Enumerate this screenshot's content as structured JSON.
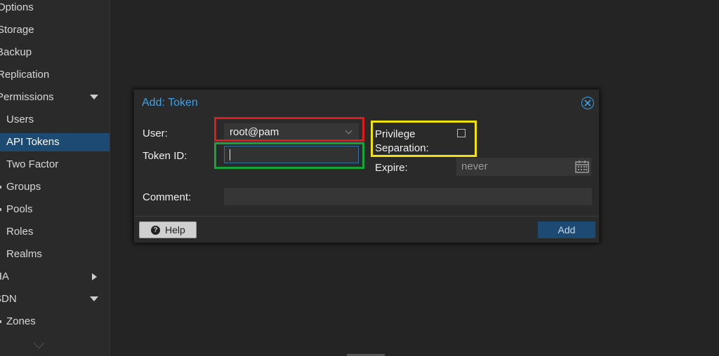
{
  "sidebar": {
    "items": [
      {
        "label": "Options"
      },
      {
        "label": "Storage"
      },
      {
        "label": "Backup"
      },
      {
        "label": "Replication"
      },
      {
        "label": "Permissions",
        "expanded": true
      },
      {
        "label": "Users"
      },
      {
        "label": "API Tokens",
        "selected": true
      },
      {
        "label": "Two Factor"
      },
      {
        "label": "Groups"
      },
      {
        "label": "Pools"
      },
      {
        "label": "Roles"
      },
      {
        "label": "Realms"
      },
      {
        "label": "HA",
        "expanded": false
      },
      {
        "label": "SDN",
        "expanded": true
      },
      {
        "label": "Zones"
      }
    ]
  },
  "dialog": {
    "title": "Add: Token",
    "user_label": "User:",
    "user_value": "root@pam",
    "token_id_label": "Token ID:",
    "token_id_value": "",
    "privsep_label_line1": "Privilege",
    "privsep_label_line2": "Separation:",
    "privsep_checked": false,
    "expire_label": "Expire:",
    "expire_value": "never",
    "comment_label": "Comment:",
    "comment_value": "",
    "help_button": "Help",
    "add_button": "Add"
  },
  "colors": {
    "accent": "#3ea0e6",
    "selected_bg": "#1d4a72",
    "highlight_red": "#e11a1a",
    "highlight_green": "#16a33a",
    "highlight_yellow": "#f2e20c"
  }
}
